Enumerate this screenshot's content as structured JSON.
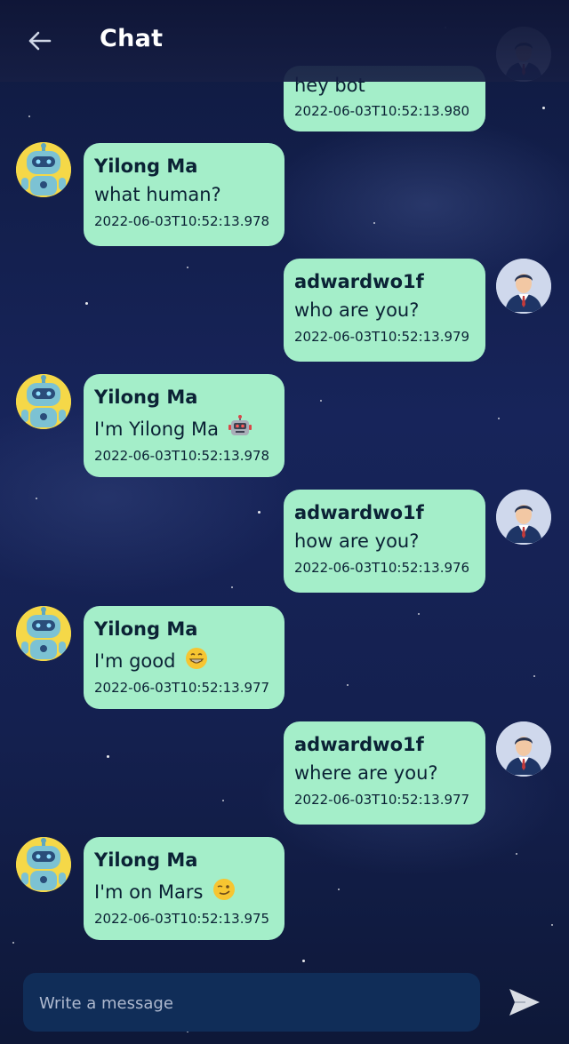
{
  "header": {
    "title": "Chat",
    "back_icon": "arrow-left-icon"
  },
  "messages": [
    {
      "side": "right",
      "sender": "",
      "text": "hey bot",
      "time": "2022-06-03T10:52:13.980",
      "avatar": "businessman-avatar"
    },
    {
      "side": "left",
      "sender": "Yilong Ma",
      "text": "what human?",
      "time": "2022-06-03T10:52:13.978",
      "avatar": "robot-avatar"
    },
    {
      "side": "right",
      "sender": "adwardwo1f",
      "text": "who are you?",
      "time": "2022-06-03T10:52:13.979",
      "avatar": "businessman-avatar"
    },
    {
      "side": "left",
      "sender": "Yilong Ma",
      "text": "I'm Yilong Ma",
      "emoji": "robot-emoji",
      "time": "2022-06-03T10:52:13.978",
      "avatar": "robot-avatar"
    },
    {
      "side": "right",
      "sender": "adwardwo1f",
      "text": "how are you?",
      "time": "2022-06-03T10:52:13.976",
      "avatar": "businessman-avatar"
    },
    {
      "side": "left",
      "sender": "Yilong Ma",
      "text": "I'm good",
      "emoji": "grin-emoji",
      "time": "2022-06-03T10:52:13.977",
      "avatar": "robot-avatar"
    },
    {
      "side": "right",
      "sender": "adwardwo1f",
      "text": "where are you?",
      "time": "2022-06-03T10:52:13.977",
      "avatar": "businessman-avatar"
    },
    {
      "side": "left",
      "sender": "Yilong Ma",
      "text": "I'm on Mars",
      "emoji": "smirk-emoji",
      "time": "2022-06-03T10:52:13.975",
      "avatar": "robot-avatar"
    }
  ],
  "composer": {
    "placeholder": "Write a message",
    "send_icon": "send-icon"
  },
  "colors": {
    "bubble": "#a4eec9",
    "bubble_text": "#0b2235",
    "composer_bg": "#102d58",
    "background": "#17245a"
  }
}
